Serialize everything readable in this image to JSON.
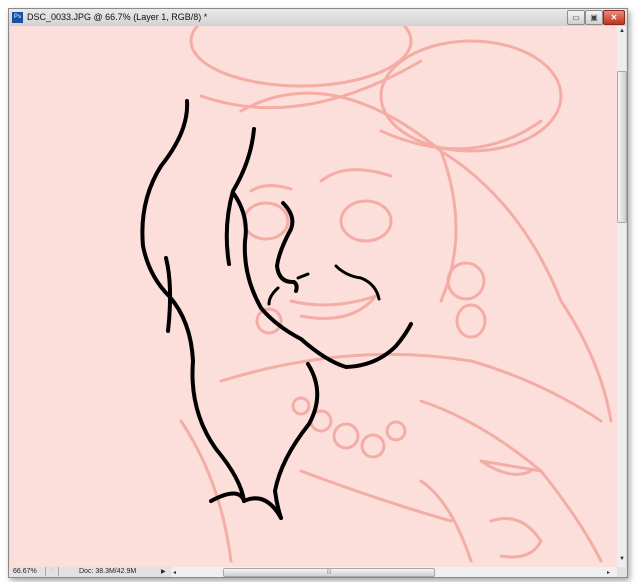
{
  "window": {
    "app_icon": "photoshop-icon",
    "app_icon_text": "Ps",
    "title": "DSC_0033.JPG @ 66.7% (Layer 1, RGB/8) *",
    "controls": {
      "minimize": "minimize-icon",
      "maximize": "maximize-icon",
      "close": "close-icon",
      "close_glyph": "✕"
    }
  },
  "status_bar": {
    "zoom": "66.67%",
    "doc_size": "Doc: 38.3M/42.9M",
    "menu_arrow": "▶"
  },
  "colors": {
    "canvas_bg": "#fcdedb",
    "sketch": "#f3a59c",
    "ink": "#000000"
  }
}
